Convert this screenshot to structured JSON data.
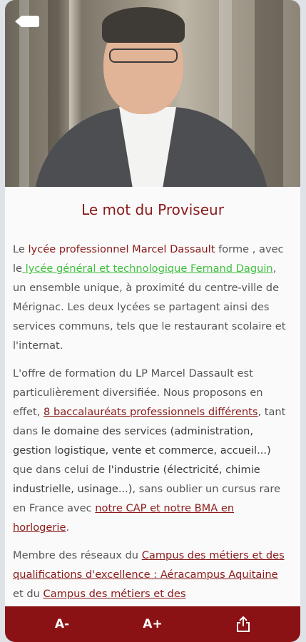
{
  "header": {
    "back_icon": "back-arrow-icon"
  },
  "page": {
    "title": "Le mot du Proviseur"
  },
  "para1": {
    "t1": "Le ",
    "t2": "lycée professionnel Marcel Dassault",
    "t3": " forme , avec le",
    "t4": " lycée général et technologique Fernand Daguin",
    "t5": ", un ensemble unique, à proximité du centre-ville de Mérignac. Les deux lycées se partagent ainsi des services communs, tels que le restaurant scolaire et l'internat."
  },
  "para2": {
    "t1": "L'offre de formation du LP Marcel Dassault est particulièrement diversifiée. Nous proposons en effet, ",
    "t2": "8 baccalauréats professionnels différents",
    "t3": ", tant dans ",
    "t4": "le domaine des services (administration, gestion logistique, vente et commerce, accueil...)",
    "t5": " que dans celui de ",
    "t6": "l'industrie (électricité, chimie industrielle, usinage...)",
    "t7": ", sans oublier un cursus rare en France avec ",
    "t8": "notre CAP et notre BMA en horlogerie",
    "t9": "."
  },
  "para3": {
    "t1": "Membre des réseaux du ",
    "t2": "Campus des métiers et des qualifications d'excellence : Aéracampus Aquitaine",
    "t3": " et du ",
    "t4": "Campus des métiers et des"
  },
  "bottom_bar": {
    "decrease_label": "A-",
    "increase_label": "A+",
    "share_icon": "share-icon"
  },
  "colors": {
    "accent": "#8b1214",
    "link_green": "#3fbf3f",
    "title": "#8a1a1a"
  }
}
